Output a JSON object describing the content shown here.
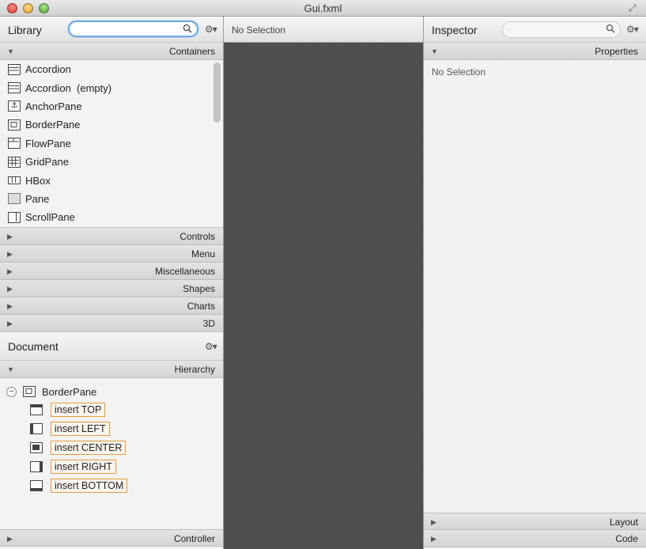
{
  "window": {
    "title": "Gui.fxml"
  },
  "library": {
    "title": "Library",
    "search": {
      "value": "",
      "placeholder": ""
    },
    "sections": {
      "containers": "Containers",
      "collapsed": [
        "Controls",
        "Menu",
        "Miscellaneous",
        "Shapes",
        "Charts",
        "3D"
      ]
    },
    "items": [
      "Accordion",
      "Accordion  (empty)",
      "AnchorPane",
      "BorderPane",
      "FlowPane",
      "GridPane",
      "HBox",
      "Pane",
      "ScrollPane"
    ]
  },
  "document": {
    "title": "Document",
    "hierarchy_label": "Hierarchy",
    "root": "BorderPane",
    "children": [
      "insert TOP",
      "insert LEFT",
      "insert CENTER",
      "insert RIGHT",
      "insert BOTTOM"
    ],
    "controller_label": "Controller"
  },
  "center": {
    "selection": "No Selection"
  },
  "inspector": {
    "title": "Inspector",
    "search": {
      "value": "",
      "placeholder": ""
    },
    "properties_label": "Properties",
    "no_selection": "No Selection",
    "layout_label": "Layout",
    "code_label": "Code"
  },
  "icons": {
    "search": "magnifier-icon",
    "gear": "gear-icon",
    "expand": "triangle-right-icon",
    "collapse": "triangle-down-icon"
  }
}
